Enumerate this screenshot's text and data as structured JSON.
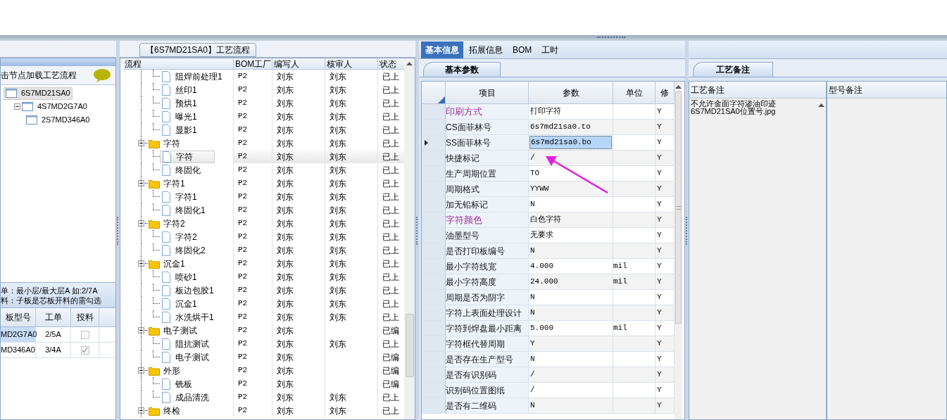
{
  "left_panel": {
    "hint": "击节点加载工艺流程",
    "tree": [
      {
        "label": "6S7MD21SA0",
        "selected": true,
        "children": [
          {
            "label": "4S7MD2G7A0",
            "selected": false,
            "children": [
              {
                "label": "2S7MD346A0",
                "selected": false
              }
            ]
          }
        ]
      }
    ],
    "notes": [
      "单：最小层/最大层A 如:2/7A",
      "料：子板是芯板开料的需勾选"
    ],
    "columns": [
      "板型号",
      "工单",
      "投料"
    ],
    "rows": [
      {
        "model": "MD2G7A0",
        "order": "2/5A",
        "checked": false,
        "selected": true
      },
      {
        "model": "MD346A0",
        "order": "3/4A",
        "checked": true,
        "selected": false
      }
    ]
  },
  "process_panel": {
    "title": "【6S7MD21SA0】工艺流程",
    "columns": [
      "流程",
      "BOM工厂",
      "编写人",
      "核审人",
      "状态"
    ],
    "groups": [
      {
        "children": [
          {
            "label": "阻焊前处理1",
            "factory": "P2",
            "author": "刘东",
            "reviewer": "刘东",
            "status": "已上",
            "selected": false
          },
          {
            "label": "丝印1",
            "factory": "P2",
            "author": "刘东",
            "reviewer": "刘东",
            "status": "已上",
            "selected": false
          },
          {
            "label": "预烘1",
            "factory": "P2",
            "author": "刘东",
            "reviewer": "刘东",
            "status": "已上",
            "selected": false
          },
          {
            "label": "曝光1",
            "factory": "P2",
            "author": "刘东",
            "reviewer": "刘东",
            "status": "已上",
            "selected": false
          },
          {
            "label": "显影1",
            "factory": "P2",
            "author": "刘东",
            "reviewer": "刘东",
            "status": "已上",
            "selected": false
          }
        ]
      },
      {
        "label": "字符",
        "factory": "P2",
        "author": "刘东",
        "reviewer": "刘东",
        "status": "已上",
        "children": [
          {
            "label": "字符",
            "factory": "P2",
            "author": "刘东",
            "reviewer": "刘东",
            "status": "已上",
            "selected": true
          },
          {
            "label": "终固化",
            "factory": "P2",
            "author": "刘东",
            "reviewer": "刘东",
            "status": "已上",
            "selected": false
          }
        ]
      },
      {
        "label": "字符1",
        "factory": "P2",
        "author": "刘东",
        "reviewer": "刘东",
        "status": "已上",
        "children": [
          {
            "label": "字符1",
            "factory": "P2",
            "author": "刘东",
            "reviewer": "刘东",
            "status": "已上",
            "selected": false
          },
          {
            "label": "终固化1",
            "factory": "P2",
            "author": "刘东",
            "reviewer": "刘东",
            "status": "已上",
            "selected": false
          }
        ]
      },
      {
        "label": "字符2",
        "factory": "P2",
        "author": "刘东",
        "reviewer": "刘东",
        "status": "已上",
        "children": [
          {
            "label": "字符2",
            "factory": "P2",
            "author": "刘东",
            "reviewer": "刘东",
            "status": "已上",
            "selected": false
          },
          {
            "label": "终固化2",
            "factory": "P2",
            "author": "刘东",
            "reviewer": "刘东",
            "status": "已上",
            "selected": false
          }
        ]
      },
      {
        "label": "沉金1",
        "factory": "P2",
        "author": "刘东",
        "reviewer": "刘东",
        "status": "已上",
        "children": [
          {
            "label": "喷砂1",
            "factory": "P2",
            "author": "刘东",
            "reviewer": "刘东",
            "status": "已上",
            "selected": false
          },
          {
            "label": "板边包胶1",
            "factory": "P2",
            "author": "刘东",
            "reviewer": "刘东",
            "status": "已上",
            "selected": false
          },
          {
            "label": "沉金1",
            "factory": "P2",
            "author": "刘东",
            "reviewer": "刘东",
            "status": "已上",
            "selected": false
          },
          {
            "label": "水洗烘干1",
            "factory": "P2",
            "author": "刘东",
            "reviewer": "刘东",
            "status": "已上",
            "selected": false
          }
        ]
      },
      {
        "label": "电子测试",
        "factory": "P2",
        "author": "刘东",
        "status": "已编",
        "children": [
          {
            "label": "阻抗测试",
            "factory": "P2",
            "author": "刘东",
            "reviewer": "刘东",
            "status": "已上",
            "selected": false
          },
          {
            "label": "电子测试",
            "factory": "P2",
            "author": "刘东",
            "status": "已编",
            "selected": false
          }
        ]
      },
      {
        "label": "外形",
        "factory": "P2",
        "author": "刘东",
        "status": "已编",
        "children": [
          {
            "label": "铣板",
            "factory": "P2",
            "author": "刘东",
            "status": "已编",
            "selected": false
          },
          {
            "label": "成品清洗",
            "factory": "P2",
            "author": "刘东",
            "reviewer": "刘东",
            "status": "已上",
            "selected": false
          }
        ]
      },
      {
        "label": "终检",
        "factory": "P2",
        "author": "刘东",
        "reviewer": "刘东",
        "status": "已上"
      }
    ]
  },
  "detail_panel": {
    "tabs": [
      {
        "label": "基本信息",
        "selected": true
      },
      {
        "label": "拓展信息",
        "selected": false
      },
      {
        "label": "BOM",
        "selected": false
      },
      {
        "label": "工时",
        "selected": false
      }
    ],
    "subtab": "基本参数",
    "columns": [
      "项目",
      "参数",
      "单位",
      "修"
    ],
    "rows": [
      {
        "item": "印刷方式",
        "value": "打印字符",
        "flag": "Y",
        "color": "#a0309c",
        "selected": false
      },
      {
        "item": "CS面菲林号",
        "value": "6s7md21sa0.to",
        "flag": "Y",
        "selected": false
      },
      {
        "item": "SS面菲林号",
        "value": "6s7md21sa0.bo",
        "flag": "Y",
        "selected": true
      },
      {
        "item": "快捷标记",
        "value": "/",
        "flag": "Y",
        "selected": false
      },
      {
        "item": "生产周期位置",
        "value": "TO",
        "flag": "Y",
        "selected": false
      },
      {
        "item": "周期格式",
        "value": "YYWW",
        "flag": "Y",
        "selected": false
      },
      {
        "item": "加无铅标记",
        "value": "N",
        "flag": "Y",
        "selected": false
      },
      {
        "item": "字符颜色",
        "value": "白色字符",
        "flag": "Y",
        "color": "#a0309c",
        "selected": false
      },
      {
        "item": "油墨型号",
        "value": "无要求",
        "flag": "Y",
        "selected": false
      },
      {
        "item": "是否打印板编号",
        "value": "N",
        "flag": "Y",
        "selected": false
      },
      {
        "item": "最小字符线宽",
        "value": "4.000",
        "unit": "mil",
        "flag": "Y",
        "selected": false
      },
      {
        "item": "最小字符高度",
        "value": "24.000",
        "unit": "mil",
        "flag": "Y",
        "selected": false
      },
      {
        "item": "周期是否为阴字",
        "value": "N",
        "flag": "Y",
        "selected": false
      },
      {
        "item": "字符上表面处理设计",
        "value": "N",
        "flag": "Y",
        "selected": false
      },
      {
        "item": "字符到焊盘最小距离",
        "value": "5.000",
        "unit": "mil",
        "flag": "Y",
        "selected": false
      },
      {
        "item": "字符框代替周期",
        "value": "Y",
        "flag": "Y",
        "selected": false
      },
      {
        "item": "是否存在生产型号",
        "value": "N",
        "flag": "Y",
        "selected": false
      },
      {
        "item": "是否有识别码",
        "value": "/",
        "flag": "Y",
        "selected": false
      },
      {
        "item": "识别码位置图纸",
        "value": "/",
        "flag": "Y",
        "selected": false
      },
      {
        "item": "是否有二维码",
        "value": "N",
        "flag": "Y",
        "selected": false
      }
    ]
  },
  "notes_panel": {
    "tab": "工艺备注",
    "columns": [
      "工艺备注",
      "型号备注"
    ],
    "process_note": [
      "不允许金面字符渗油印迹",
      "6S7MD21SA0位置号.jpg"
    ]
  }
}
